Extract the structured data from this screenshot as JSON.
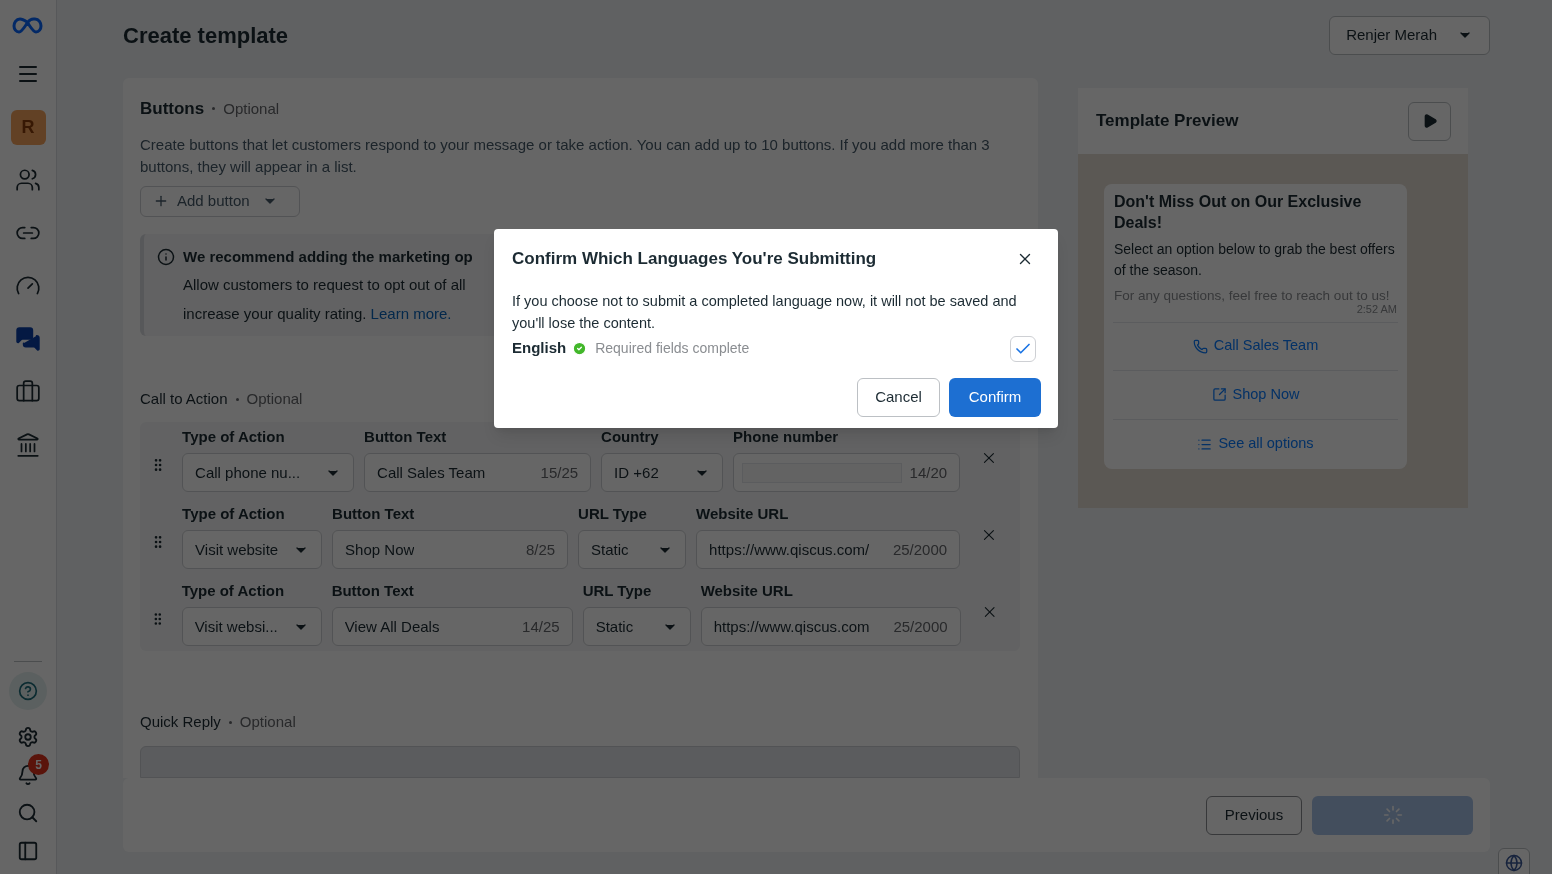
{
  "sidebar": {
    "avatar": "R",
    "notifications": "5",
    "items": [
      {
        "kind": "people",
        "selected": false
      },
      {
        "kind": "link",
        "selected": false
      },
      {
        "kind": "gauge",
        "selected": false
      },
      {
        "kind": "chat",
        "selected": true
      },
      {
        "kind": "briefcase",
        "selected": false
      },
      {
        "kind": "bank",
        "selected": false
      }
    ]
  },
  "header": {
    "title": "Create template",
    "account": "Renjer Merah"
  },
  "buttons_section": {
    "title": "Buttons",
    "optional": "Optional",
    "description": "Create buttons that let customers respond to your message or take action. You can add up to 10 buttons. If you add more than 3 buttons, they will appear in a list.",
    "add_button": "Add button",
    "banner": {
      "title": "We recommend adding the marketing op",
      "body": "Allow customers to request to opt out of all",
      "body2": "increase your quality rating.",
      "link": "Learn more."
    }
  },
  "call_to_action": {
    "title": "Call to Action",
    "optional": "Optional",
    "rows": [
      {
        "fields": [
          {
            "kind": "select",
            "label": "Type of Action",
            "value": "Call phone nu..."
          },
          {
            "kind": "text",
            "label": "Button Text",
            "value": "Call Sales Team",
            "count": "15/25"
          },
          {
            "kind": "select",
            "label": "Country",
            "value": "ID +62"
          },
          {
            "kind": "redacted",
            "label": "Phone number",
            "count": "14/20"
          }
        ]
      },
      {
        "fields": [
          {
            "kind": "select",
            "label": "Type of Action",
            "value": "Visit website"
          },
          {
            "kind": "text",
            "label": "Button Text",
            "value": "Shop Now",
            "count": "8/25"
          },
          {
            "kind": "select",
            "label": "URL Type",
            "value": "Static"
          },
          {
            "kind": "text",
            "label": "Website URL",
            "value": "https://www.qiscus.com/",
            "count": "25/2000"
          }
        ]
      },
      {
        "fields": [
          {
            "kind": "select",
            "label": "Type of Action",
            "value": "Visit websi..."
          },
          {
            "kind": "text",
            "label": "Button Text",
            "value": "View All Deals",
            "count": "14/25"
          },
          {
            "kind": "select",
            "label": "URL Type",
            "value": "Static"
          },
          {
            "kind": "text",
            "label": "Website URL",
            "value": "https://www.qiscus.com",
            "count": "25/2000"
          }
        ]
      }
    ]
  },
  "quick_reply": {
    "title": "Quick Reply",
    "optional": "Optional"
  },
  "preview": {
    "title": "Template Preview",
    "message": {
      "header": "Don't Miss Out on Our Exclusive Deals!",
      "body": "Select an option below to grab the best offers of the season.",
      "footer": "For any questions, feel free to reach out to us!",
      "time": "2:52 AM"
    },
    "buttons": [
      {
        "kind": "phone",
        "label": "Call Sales Team"
      },
      {
        "kind": "external",
        "label": "Shop Now"
      },
      {
        "kind": "list",
        "label": "See all options"
      }
    ]
  },
  "footer": {
    "previous": "Previous",
    "next_loading": true
  },
  "dialog": {
    "title": "Confirm Which Languages You're Submitting",
    "body": "If you choose not to submit a completed language now, it will not be saved and you'll lose the content.",
    "language": "English",
    "status": "Required fields complete",
    "checked": true,
    "cancel": "Cancel",
    "confirm": "Confirm"
  }
}
